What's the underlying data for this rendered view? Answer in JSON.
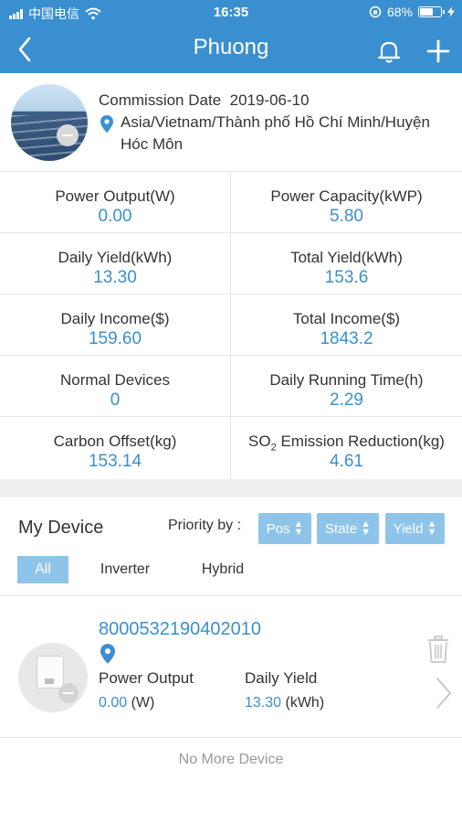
{
  "status_bar": {
    "carrier": "中国电信",
    "time": "16:35",
    "battery_percent": "68%",
    "battery_level": 0.68,
    "icons": [
      "signal-icon",
      "wifi-icon",
      "orientation-lock-icon",
      "battery-icon",
      "charging-icon"
    ]
  },
  "header": {
    "title": "Phuong",
    "icons": [
      "back-icon",
      "bell-icon",
      "plus-icon"
    ]
  },
  "plant": {
    "commission_label": "Commission Date",
    "commission_date": "2019-06-10",
    "location": "Asia/Vietnam/Thành phố Hồ Chí Minh/Huyện Hóc Môn"
  },
  "stats": [
    {
      "label": "Power Output(W)",
      "value": "0.00"
    },
    {
      "label": "Power Capacity(kWP)",
      "value": "5.80"
    },
    {
      "label": "Daily Yield(kWh)",
      "value": "13.30"
    },
    {
      "label": "Total Yield(kWh)",
      "value": "153.6"
    },
    {
      "label": "Daily Income($)",
      "value": "159.60"
    },
    {
      "label": "Total Income($)",
      "value": "1843.2"
    },
    {
      "label": "Normal Devices",
      "value": "0"
    },
    {
      "label": "Daily Running Time(h)",
      "value": "2.29"
    },
    {
      "label": "Carbon Offset(kg)",
      "value": "153.14"
    },
    {
      "label_prefix": "SO",
      "label_sub": "2",
      "label_suffix": " Emission Reduction(kg)",
      "value": "4.61"
    }
  ],
  "devices_section": {
    "title": "My Device",
    "priority_label": "Priority by :",
    "priority_buttons": [
      "Pos",
      "State",
      "Yield"
    ],
    "filter_tabs": [
      "All",
      "Inverter",
      "Hybrid"
    ],
    "active_tab": "All"
  },
  "device": {
    "serial": "8000532190402010",
    "power_output_label": "Power Output",
    "power_output_value": "0.00",
    "power_output_unit": "(W)",
    "daily_yield_label": "Daily Yield",
    "daily_yield_value": "13.30",
    "daily_yield_unit": "(kWh)"
  },
  "footer_text": "No More Device",
  "colors": {
    "header": "#3a8fd0",
    "accent_text": "#3a8fd0",
    "button_bg": "#8ec4ea",
    "divider": "#e6e6e6",
    "section_gap": "#efefef"
  }
}
